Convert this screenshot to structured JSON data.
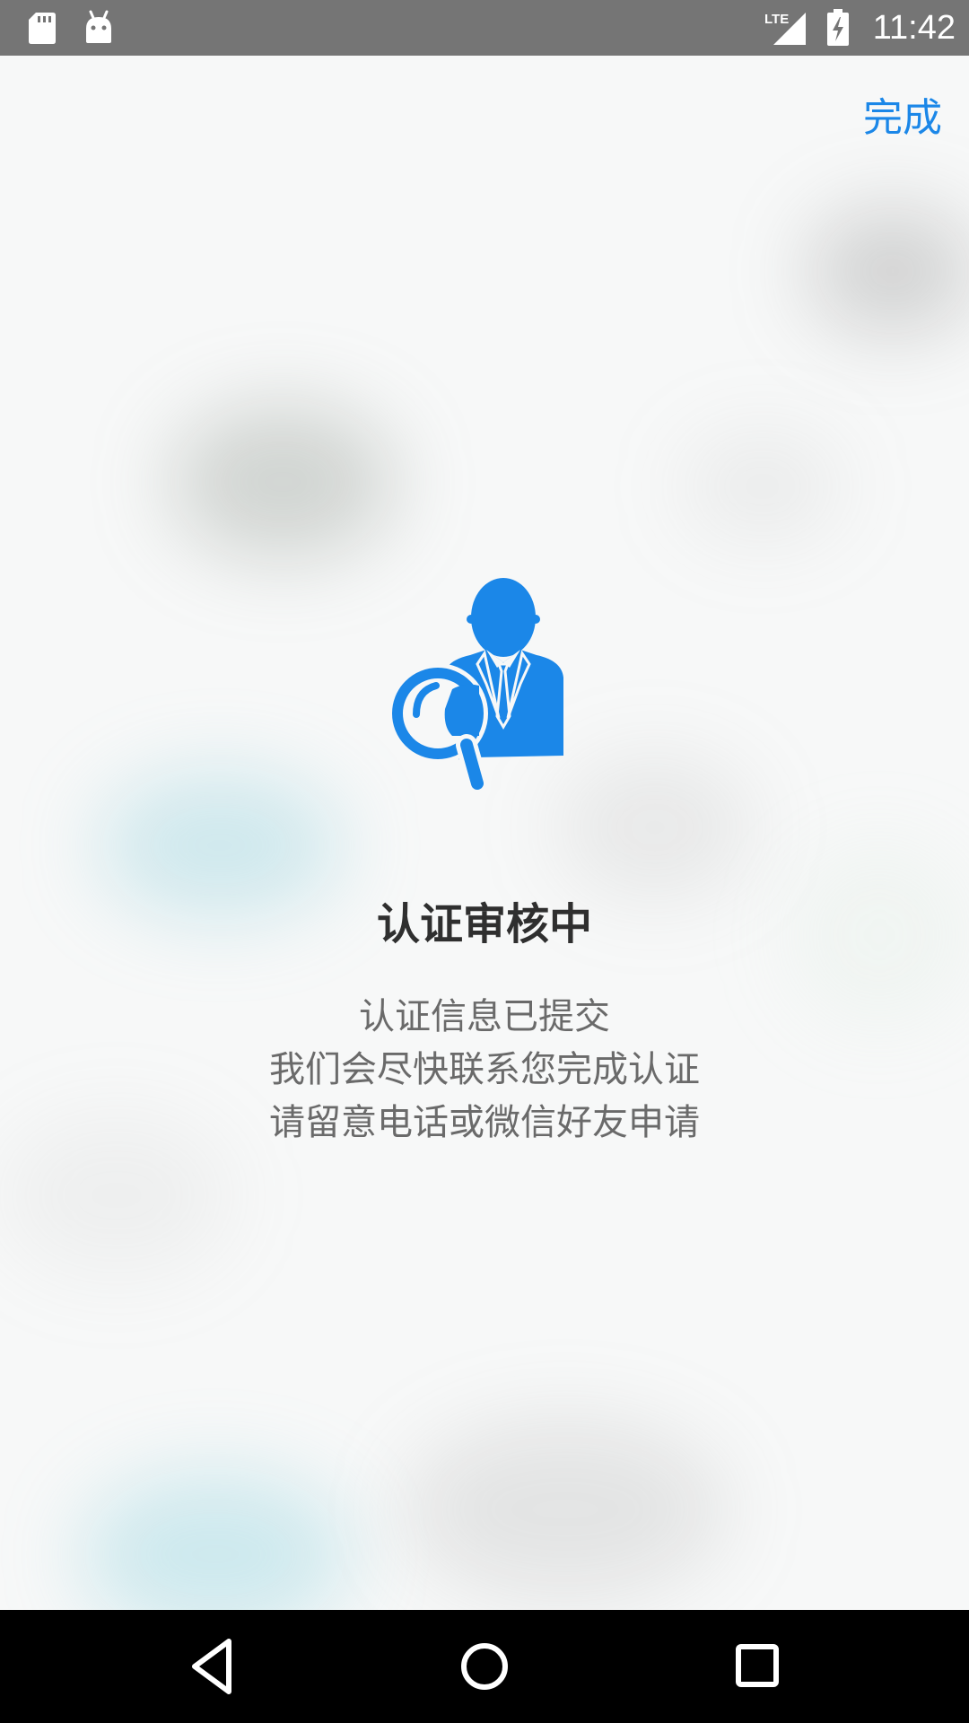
{
  "status_bar": {
    "time": "11:42",
    "signal_label": "LTE",
    "icons": [
      "sd-card-icon",
      "android-icon",
      "lte-signal-icon",
      "battery-charging-icon"
    ]
  },
  "toolbar": {
    "done_label": "完成"
  },
  "status": {
    "icon": "user-search-icon",
    "title": "认证审核中",
    "message_lines": [
      "认证信息已提交",
      "我们会尽快联系您完成认证",
      "请留意电话或微信好友申请"
    ]
  },
  "nav_bar": {
    "icons": [
      "back-icon",
      "home-icon",
      "recents-icon"
    ]
  },
  "colors": {
    "accent": "#1b87e8",
    "status_bar": "#757575",
    "title_text": "#2f2f2f",
    "body_text": "#6a6a6a"
  }
}
